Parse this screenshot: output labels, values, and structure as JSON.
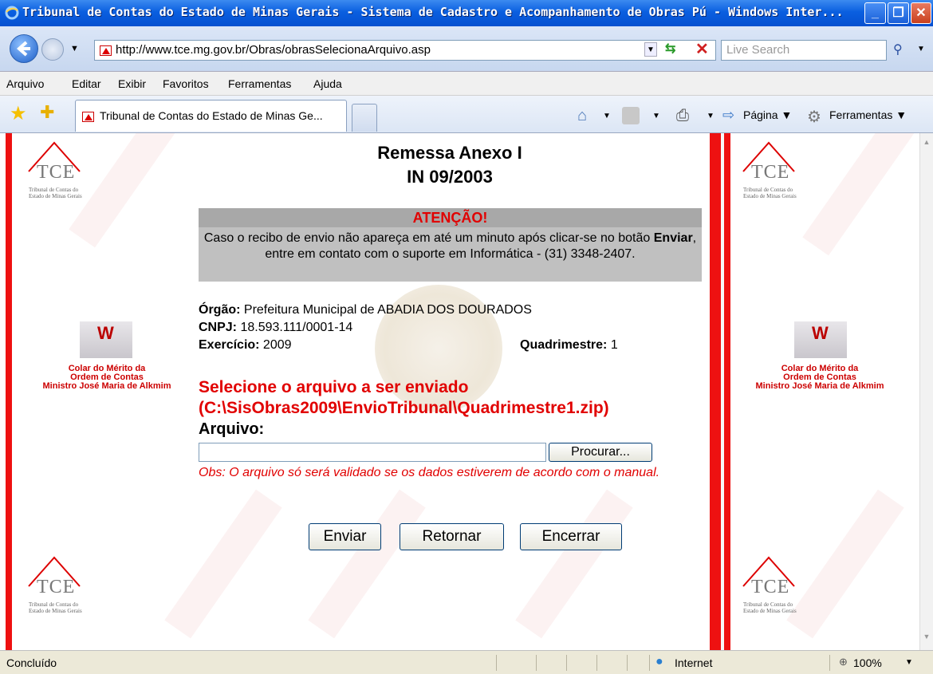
{
  "window": {
    "title": "Tribunal de Contas do Estado de Minas Gerais - Sistema de Cadastro e Acompanhamento de Obras Pú - Windows Inter..."
  },
  "address": {
    "url": "http://www.tce.mg.gov.br/Obras/obrasSelecionaArquivo.asp",
    "search_placeholder": "Live Search"
  },
  "menu": [
    "Arquivo",
    "Editar",
    "Exibir",
    "Favoritos",
    "Ferramentas",
    "Ajuda"
  ],
  "tab": {
    "label": "Tribunal de Contas do Estado de Minas Ge..."
  },
  "toolbar": {
    "page_label": "Página",
    "tools_label": "Ferramentas"
  },
  "side": {
    "tce_logo_text": "TCE",
    "tce_logo_sub1": "Tribunal de Contas do",
    "tce_logo_sub2": "Estado de Minas Gerais",
    "colar_line1": "Colar do Mérito da",
    "colar_line2": "Ordem de Contas",
    "colar_line3": "Ministro José Maria de Alkmim"
  },
  "page": {
    "heading_line1": "Remessa Anexo I",
    "heading_line2": "IN 09/2003",
    "notice_title": "ATENÇÃO!",
    "notice_text_before": "Caso o recibo de envio não apareça em até um minuto após clicar-se no botão ",
    "notice_text_bold": "Enviar",
    "notice_text_after": ", entre em contato com o suporte em Informática - (31) 3348-2407.",
    "orgao_label": "Órgão:",
    "orgao_value": " Prefeitura Municipal de ABADIA DOS DOURADOS",
    "cnpj_label": "CNPJ:",
    "cnpj_value": " 18.593.111/0001-14",
    "exercicio_label": "Exercício:",
    "exercicio_value": " 2009",
    "quadrimestre_label": "Quadrimestre:",
    "quadrimestre_value": " 1",
    "select_line1": "Selecione o arquivo a ser enviado",
    "select_line2": "(C:\\SisObras2009\\EnvioTribunal\\Quadrimestre1.zip)",
    "arquivo_label": "Arquivo:",
    "browse_button": "Procurar...",
    "obs_text": "Obs: O arquivo só será validado se os dados estiverem de acordo com o manual.",
    "buttons": [
      "Enviar",
      "Retornar",
      "Encerrar"
    ]
  },
  "status": {
    "text": "Concluído",
    "zone": "Internet",
    "zoom": "100%"
  },
  "colors": {
    "alert_red": "#e10000",
    "stripe_red": "#e11111",
    "notice_gray": "#c0c0c0"
  }
}
